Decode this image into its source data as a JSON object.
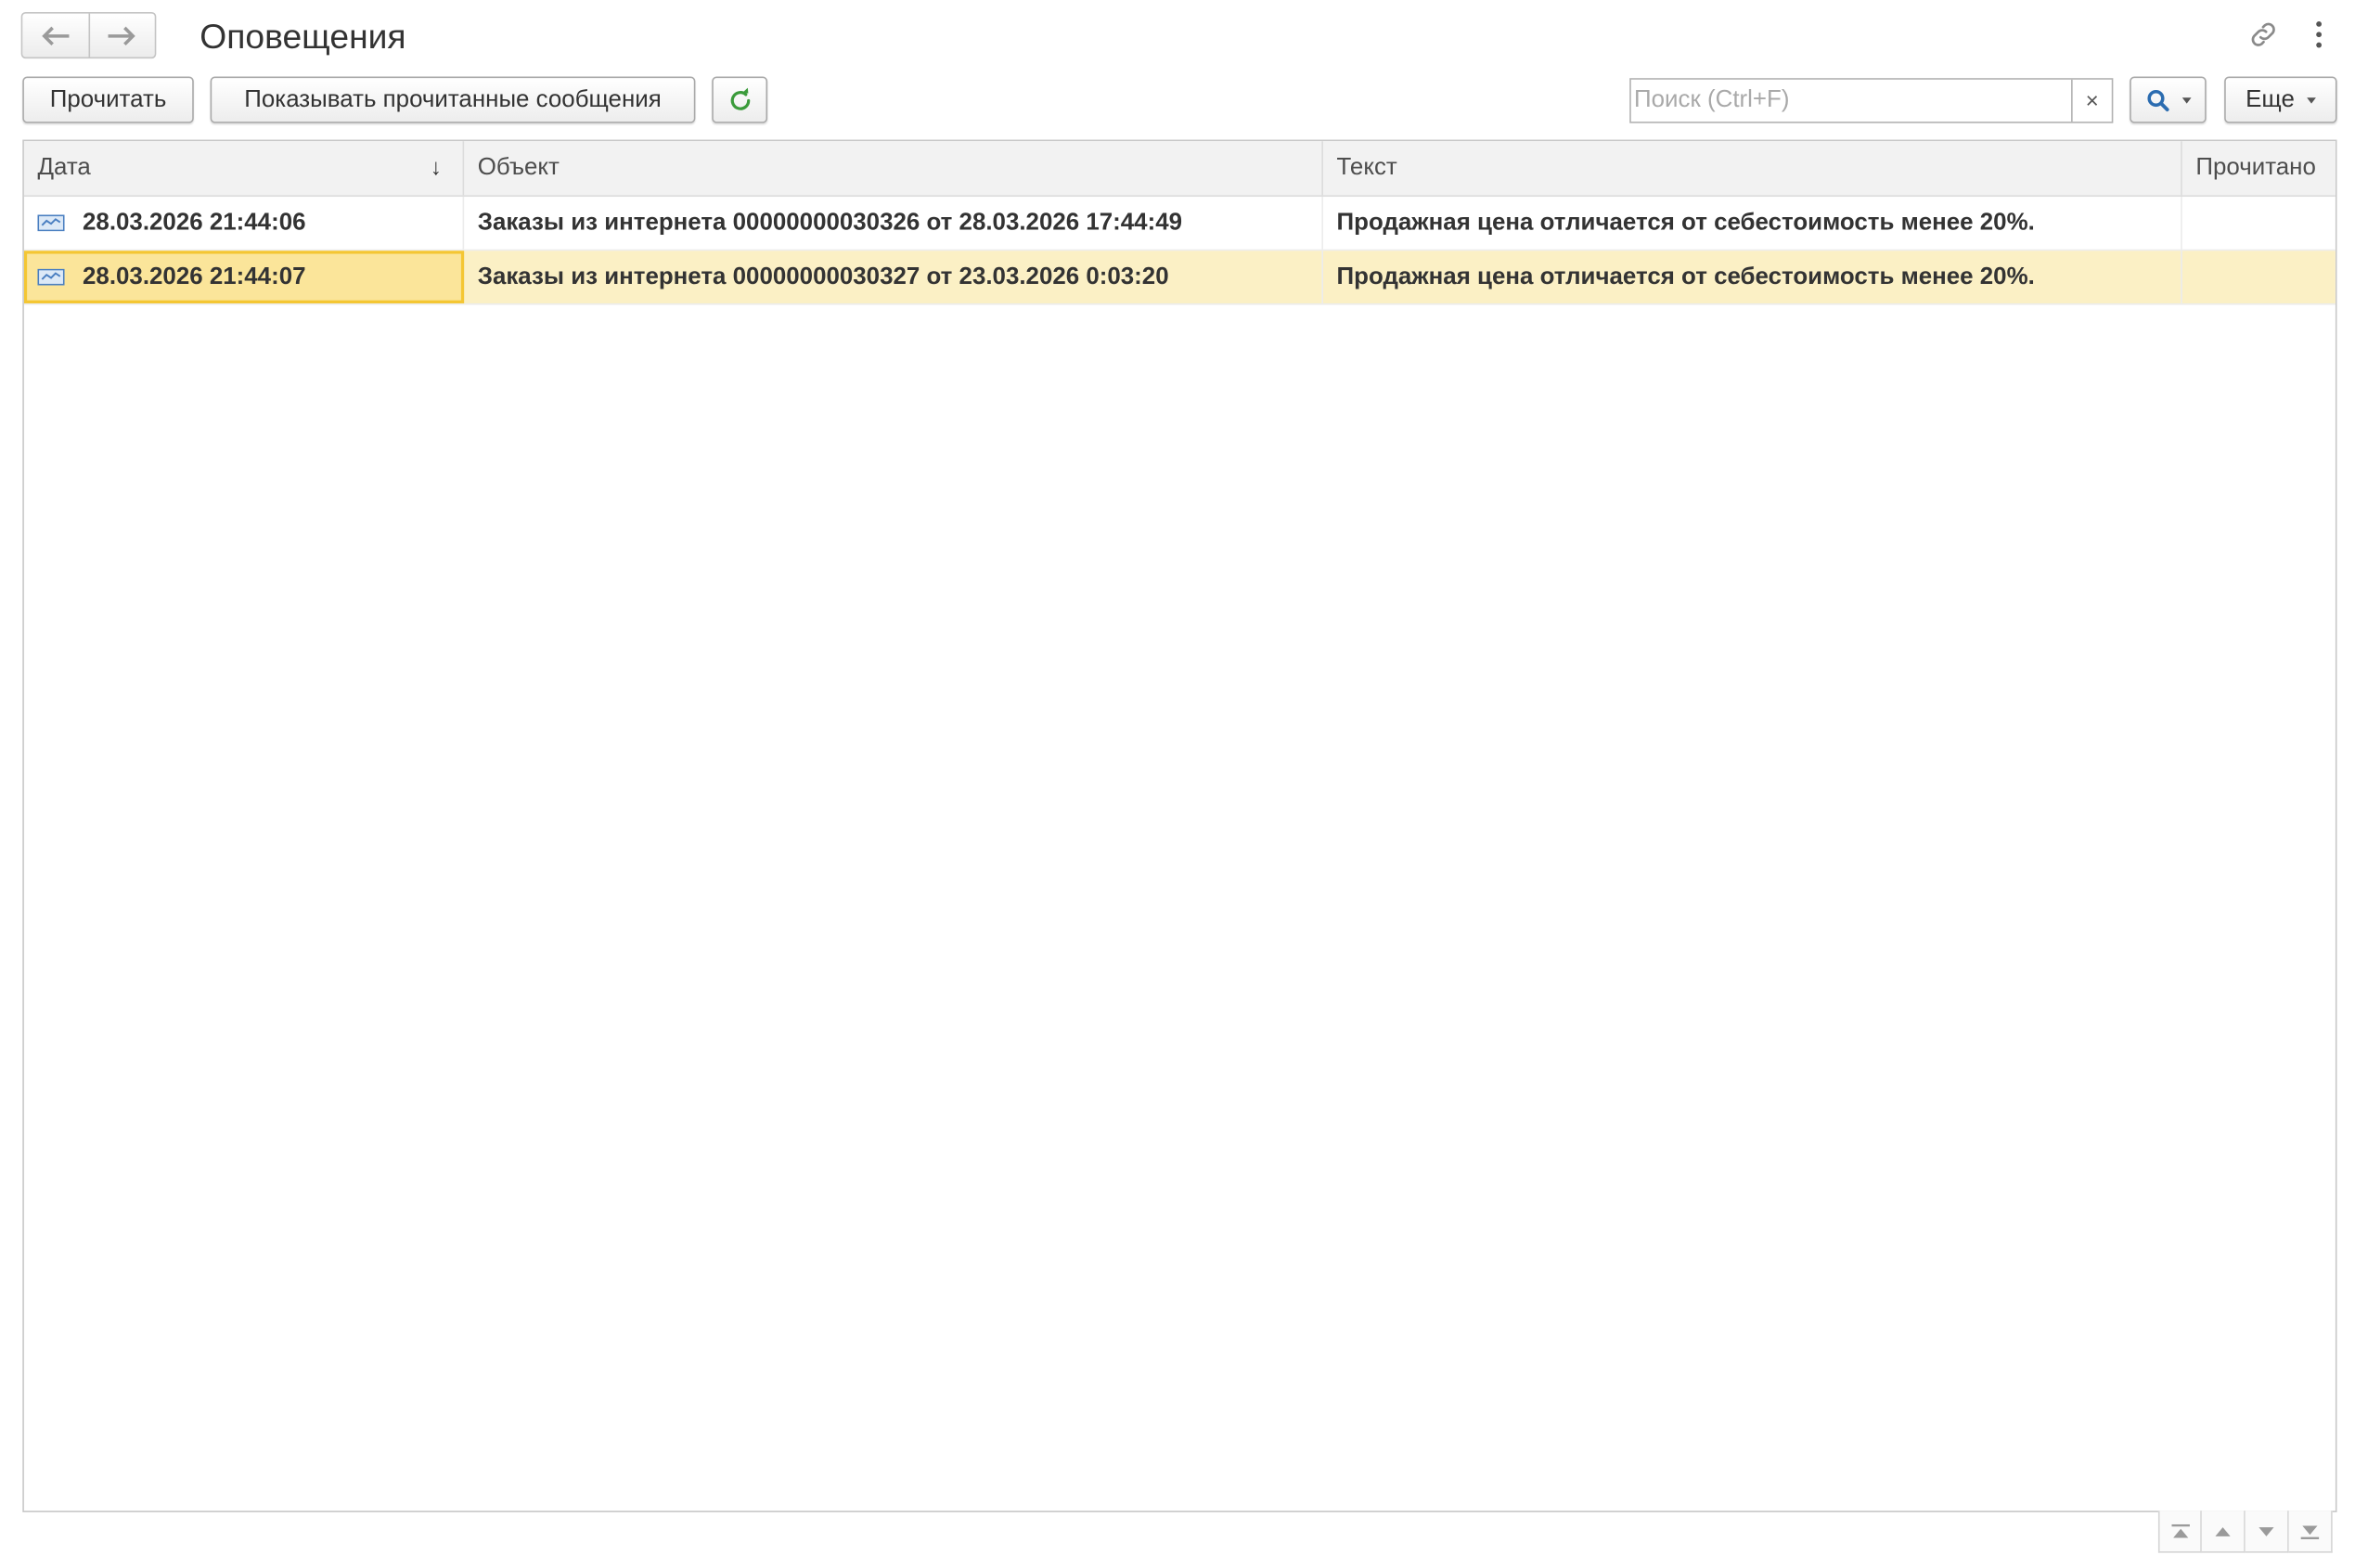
{
  "header": {
    "title": "Оповещения",
    "back_icon": "arrow-left-icon",
    "forward_icon": "arrow-right-icon",
    "link_icon": "link-icon",
    "more_icon": "kebab-icon"
  },
  "toolbar": {
    "read_label": "Прочитать",
    "show_read_label": "Показывать прочитанные сообщения",
    "refresh_icon": "refresh-icon",
    "search_placeholder": "Поиск (Ctrl+F)",
    "search_clear": "×",
    "more_label": "Еще"
  },
  "table": {
    "columns": {
      "date": "Дата",
      "object": "Объект",
      "text": "Текст",
      "read": "Прочитано"
    },
    "sort_indicator": "↓",
    "rows": [
      {
        "date": "28.03.2026 21:44:06",
        "object": "Заказы из интернета 00000000030326 от 28.03.2026 17:44:49",
        "text": "Продажная цена отличается от себестоимость менее 20%.",
        "read": ""
      },
      {
        "date": "28.03.2026 21:44:07",
        "object": "Заказы из интернета 00000000030327 от 23.03.2026 0:03:20",
        "text": "Продажная цена отличается от себестоимость менее 20%.",
        "read": ""
      }
    ]
  },
  "colors": {
    "selected_row": "#fbf0c5",
    "selected_cell": "#fbe59a",
    "selected_border": "#f4c633",
    "refresh_green": "#3b9b3b",
    "search_blue": "#2b6cb0"
  }
}
